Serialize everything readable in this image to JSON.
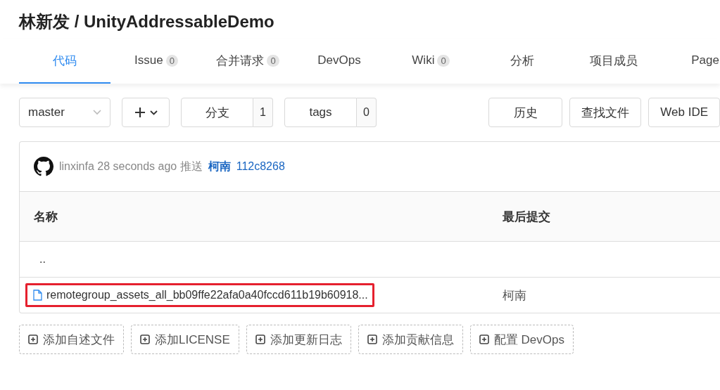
{
  "repo_title": "林新发 / UnityAddressableDemo",
  "tabs": [
    {
      "label": "代码",
      "selected": true
    },
    {
      "label": "Issue",
      "count": "0",
      "selected": false
    },
    {
      "label": "合并请求",
      "count": "0",
      "selected": false
    },
    {
      "label": "DevOps",
      "selected": false
    },
    {
      "label": "Wiki",
      "count": "0",
      "selected": false
    },
    {
      "label": "分析",
      "selected": false
    },
    {
      "label": "项目成员",
      "selected": false
    },
    {
      "label": "Page",
      "selected": false
    }
  ],
  "toolbar": {
    "branch": "master",
    "branches_label": "分支",
    "branches_count": "1",
    "tags_label": "tags",
    "tags_count": "0",
    "actions": [
      "历史",
      "查找文件",
      "Web IDE"
    ]
  },
  "commit": {
    "author": "linxinfa",
    "time": "28 seconds ago",
    "verb": "推送",
    "branch": "柯南",
    "hash": "112c8268"
  },
  "table": {
    "columns": [
      "名称",
      "最后提交"
    ],
    "rows": [
      {
        "kind": "parent",
        "name": "..",
        "highlighted": false
      },
      {
        "kind": "file",
        "name": "remotegroup_assets_all_bb09ffe22afa0a40fccd611b19b60918...",
        "last_commit": "柯南",
        "highlighted": true
      }
    ]
  },
  "add_buttons": [
    "添加自述文件",
    "添加LICENSE",
    "添加更新日志",
    "添加贡献信息",
    "配置 DevOps"
  ]
}
